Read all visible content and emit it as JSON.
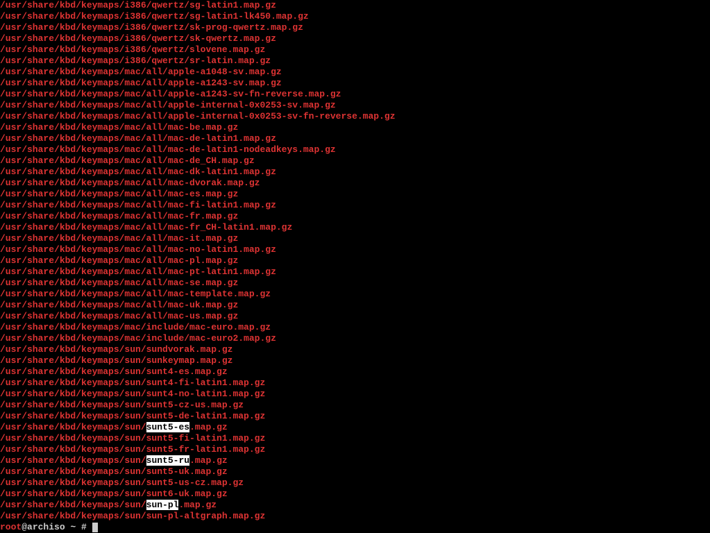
{
  "files": [
    "/usr/share/kbd/keymaps/i386/qwertz/sg-latin1.map.gz",
    "/usr/share/kbd/keymaps/i386/qwertz/sg-latin1-lk450.map.gz",
    "/usr/share/kbd/keymaps/i386/qwertz/sk-prog-qwertz.map.gz",
    "/usr/share/kbd/keymaps/i386/qwertz/sk-qwertz.map.gz",
    "/usr/share/kbd/keymaps/i386/qwertz/slovene.map.gz",
    "/usr/share/kbd/keymaps/i386/qwertz/sr-latin.map.gz",
    "/usr/share/kbd/keymaps/mac/all/apple-a1048-sv.map.gz",
    "/usr/share/kbd/keymaps/mac/all/apple-a1243-sv.map.gz",
    "/usr/share/kbd/keymaps/mac/all/apple-a1243-sv-fn-reverse.map.gz",
    "/usr/share/kbd/keymaps/mac/all/apple-internal-0x0253-sv.map.gz",
    "/usr/share/kbd/keymaps/mac/all/apple-internal-0x0253-sv-fn-reverse.map.gz",
    "/usr/share/kbd/keymaps/mac/all/mac-be.map.gz",
    "/usr/share/kbd/keymaps/mac/all/mac-de-latin1.map.gz",
    "/usr/share/kbd/keymaps/mac/all/mac-de-latin1-nodeadkeys.map.gz",
    "/usr/share/kbd/keymaps/mac/all/mac-de_CH.map.gz",
    "/usr/share/kbd/keymaps/mac/all/mac-dk-latin1.map.gz",
    "/usr/share/kbd/keymaps/mac/all/mac-dvorak.map.gz",
    "/usr/share/kbd/keymaps/mac/all/mac-es.map.gz",
    "/usr/share/kbd/keymaps/mac/all/mac-fi-latin1.map.gz",
    "/usr/share/kbd/keymaps/mac/all/mac-fr.map.gz",
    "/usr/share/kbd/keymaps/mac/all/mac-fr_CH-latin1.map.gz",
    "/usr/share/kbd/keymaps/mac/all/mac-it.map.gz",
    "/usr/share/kbd/keymaps/mac/all/mac-no-latin1.map.gz",
    "/usr/share/kbd/keymaps/mac/all/mac-pl.map.gz",
    "/usr/share/kbd/keymaps/mac/all/mac-pt-latin1.map.gz",
    "/usr/share/kbd/keymaps/mac/all/mac-se.map.gz",
    "/usr/share/kbd/keymaps/mac/all/mac-template.map.gz",
    "/usr/share/kbd/keymaps/mac/all/mac-uk.map.gz",
    "/usr/share/kbd/keymaps/mac/all/mac-us.map.gz",
    "/usr/share/kbd/keymaps/mac/include/mac-euro.map.gz",
    "/usr/share/kbd/keymaps/mac/include/mac-euro2.map.gz",
    "/usr/share/kbd/keymaps/sun/sundvorak.map.gz",
    "/usr/share/kbd/keymaps/sun/sunkeymap.map.gz",
    "/usr/share/kbd/keymaps/sun/sunt4-es.map.gz",
    "/usr/share/kbd/keymaps/sun/sunt4-fi-latin1.map.gz",
    "/usr/share/kbd/keymaps/sun/sunt4-no-latin1.map.gz",
    "/usr/share/kbd/keymaps/sun/sunt5-cz-us.map.gz",
    "/usr/share/kbd/keymaps/sun/sunt5-de-latin1.map.gz"
  ],
  "highlighted_lines": [
    {
      "prefix": "/usr/share/kbd/keymaps/sun/",
      "highlight": "sunt5-es",
      "suffix": ".map.gz"
    }
  ],
  "files2": [
    "/usr/share/kbd/keymaps/sun/sunt5-fi-latin1.map.gz",
    "/usr/share/kbd/keymaps/sun/sunt5-fr-latin1.map.gz"
  ],
  "highlighted_lines2": [
    {
      "prefix": "/usr/share/kbd/keymaps/sun/",
      "highlight": "sunt5-ru",
      "suffix": ".map.gz"
    }
  ],
  "files3": [
    "/usr/share/kbd/keymaps/sun/sunt5-uk.map.gz",
    "/usr/share/kbd/keymaps/sun/sunt5-us-cz.map.gz",
    "/usr/share/kbd/keymaps/sun/sunt6-uk.map.gz"
  ],
  "highlighted_lines3": [
    {
      "prefix": "/usr/share/kbd/keymaps/sun/",
      "highlight": "sun-pl",
      "suffix": ".map.gz"
    }
  ],
  "files4": [
    "/usr/share/kbd/keymaps/sun/sun-pl-altgraph.map.gz"
  ],
  "prompt": {
    "user": "root",
    "at": "@",
    "host": "archiso",
    "sep": " ~ # "
  }
}
